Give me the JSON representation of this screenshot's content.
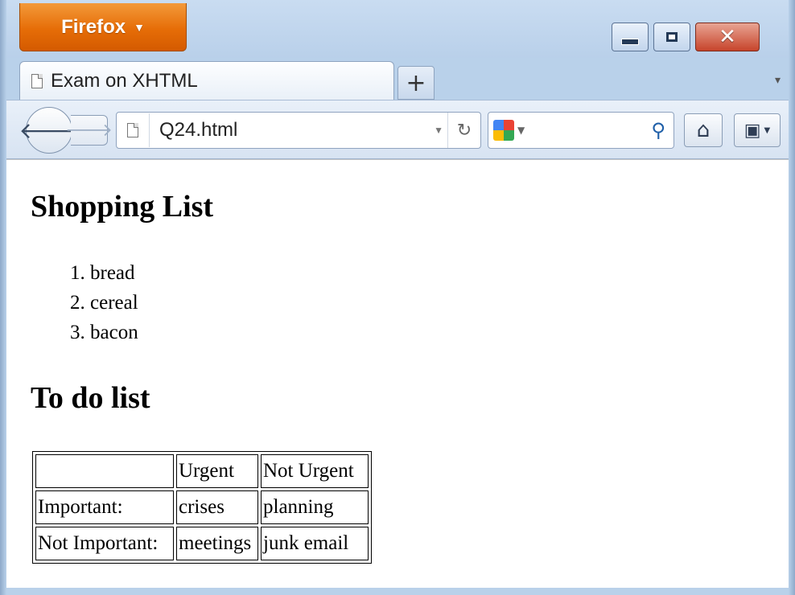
{
  "browser": {
    "menu_button": "Firefox",
    "tab_title": "Exam on XHTML",
    "new_tab": "+",
    "url": "Q24.html"
  },
  "page": {
    "heading1": "Shopping List",
    "shopping_items": [
      "bread",
      "cereal",
      "bacon"
    ],
    "heading2": "To do list",
    "table": {
      "header": [
        "",
        "Urgent",
        "Not Urgent"
      ],
      "rows": [
        [
          "Important:",
          "crises",
          "planning"
        ],
        [
          "Not Important:",
          "meetings",
          "junk email"
        ]
      ]
    }
  },
  "colors": {
    "firefox_button": "#e66d07",
    "close_button": "#c7442b",
    "chrome_frame": "#b9d1ea"
  },
  "icons": [
    "page-icon",
    "back-arrow-icon",
    "forward-arrow-icon",
    "reload-icon",
    "google-icon",
    "magnifier-icon",
    "home-icon",
    "bookmarks-icon",
    "minimize-icon",
    "maximize-icon",
    "close-icon"
  ]
}
